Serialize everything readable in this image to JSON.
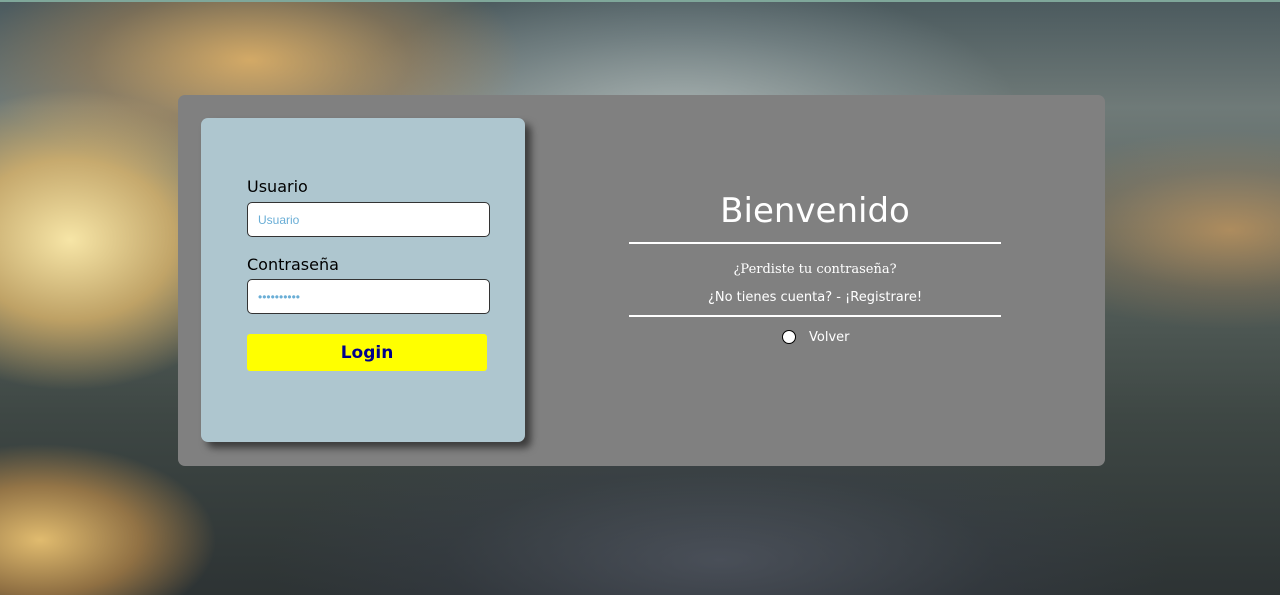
{
  "login": {
    "username_label": "Usuario",
    "username_placeholder": "Usuario",
    "password_label": "Contraseña",
    "password_value": "••••••••••",
    "submit_label": "Login"
  },
  "welcome": {
    "title": "Bienvenido",
    "forgot_password": "¿Perdiste tu contraseña?",
    "register": "¿No tienes cuenta? - ¡Registrare!",
    "back_label": "Volver"
  },
  "colors": {
    "card_bg": "#808080",
    "login_panel_bg": "#aec6cf",
    "button_bg": "#ffff00",
    "button_text": "#00008b",
    "placeholder_text": "#6aaed6"
  }
}
